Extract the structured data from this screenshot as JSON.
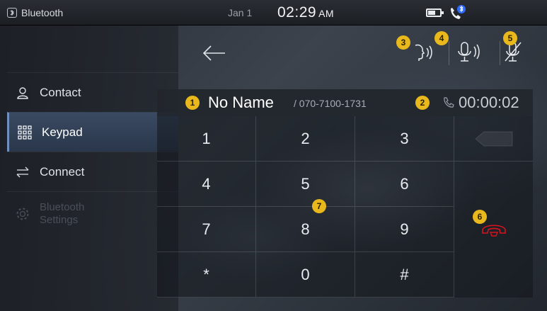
{
  "status_bar": {
    "source_label": "Bluetooth",
    "date": "Jan 1",
    "time": "02:29",
    "ampm": "AM",
    "battery_level": 0.6,
    "icons": [
      "bluetooth-icon",
      "battery-icon",
      "bluetooth-phone-icon"
    ]
  },
  "sidebar": {
    "items": [
      {
        "label": "Contact",
        "icon": "contact-icon",
        "active": false,
        "enabled": true
      },
      {
        "label": "Keypad",
        "icon": "keypad-icon",
        "active": true,
        "enabled": true
      },
      {
        "label": "Connect",
        "icon": "connect-icon",
        "active": false,
        "enabled": true
      },
      {
        "label_line1": "Bluetooth",
        "label_line2": "Settings",
        "icon": "settings-icon",
        "active": false,
        "enabled": false
      }
    ]
  },
  "call": {
    "name": "No Name",
    "number": "/ 070-7100-1731",
    "timer": "00:00:02"
  },
  "badges": [
    "1",
    "2",
    "3",
    "4",
    "5",
    "6",
    "7"
  ],
  "keypad": {
    "keys": [
      "1",
      "2",
      "3",
      "4",
      "5",
      "6",
      "7",
      "8",
      "9",
      "*",
      "0",
      "#"
    ]
  },
  "colors": {
    "badge": "#e9b81c",
    "end_call": "#d8131e",
    "active_item": "#33425a",
    "bt_blue": "#2f6bff"
  }
}
